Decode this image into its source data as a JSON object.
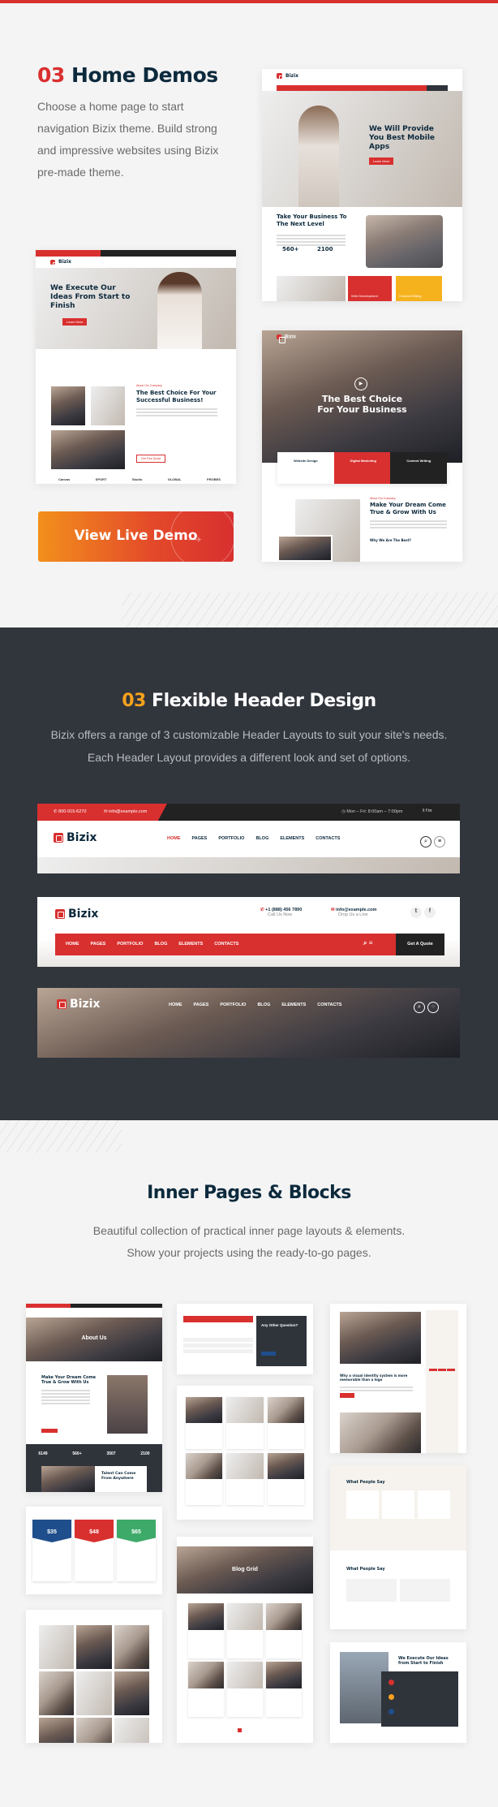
{
  "colors": {
    "accent": "#d8302f",
    "dark": "#2f343b",
    "navy": "#0d2a3d",
    "yellow": "#f6a21d"
  },
  "home_demos": {
    "number": "03",
    "title": "Home Demos",
    "description": "Choose a home page to start navigation Bizix theme. Build strong and impressive websites using Bizix pre-made theme.",
    "button": "View Live Demo",
    "demo1": {
      "logo": "Bizix",
      "hero": "We Will Provide You Best Mobile Apps",
      "section": "Take Your Business To The Next Level",
      "stat1": "560+",
      "stat2": "2100",
      "tile1": "Web Development",
      "tile2": "Content Writing",
      "cta": "Learn More"
    },
    "demo2": {
      "logo": "Bizix",
      "hero": "We Execute Our Ideas From Start to Finish",
      "section": "The Best Choice For Your Successful Business!",
      "kicker": "About Our Company",
      "cta": "Learn More",
      "cta2": "Get Free Quote",
      "brands": [
        "Canvas",
        "SPORT",
        "Studio",
        "GLOBAL",
        "PROBES"
      ]
    },
    "demo3": {
      "logo": "Bizix",
      "hero": "The Best Choice For Your Business",
      "box1": "Website Design",
      "box2": "Digital Marketing",
      "box3": "Content Writing",
      "section": "Make Your Dream Come True & Grow With Us",
      "sub": "Why We Are The Best?",
      "kicker": "About Our Company"
    }
  },
  "header_design": {
    "number": "03",
    "title": "Flexible Header Design",
    "description": "Bizix offers a range of 3 customizable Header Layouts to suit your site's needs. Each Header Layout provides a different look and set of options.",
    "nav": [
      "HOME",
      "PAGES",
      "PORTFOLIO",
      "BLOG",
      "ELEMENTS",
      "CONTACTS"
    ],
    "logo": "Bizix",
    "h1": {
      "phone": "800-915-6270",
      "email": "info@example.com",
      "hours": "Mon – Fri: 8:00am – 7:00pm"
    },
    "h2": {
      "phone": "+1 (888) 456 7890",
      "phone_sub": "Call Us Now",
      "email": "info@example.com",
      "email_sub": "Drop Us a Line",
      "quote": "Get A Quote"
    }
  },
  "inner_pages": {
    "title": "Inner Pages & Blocks",
    "description_line1": "Beautiful collection of practical inner page layouts & elements.",
    "description_line2": "Show your projects using the ready-to-go pages.",
    "about": {
      "banner": "About Us",
      "section": "Make Your Dream Come True & Grow With Us",
      "stats": [
        "6149",
        "560+",
        "3507",
        "2100"
      ],
      "talent": "Talent Can Come From Anywhere"
    },
    "pricing": [
      "$35",
      "$48",
      "$65"
    ],
    "faq": {
      "question": "Any Other Question?"
    },
    "blog_single": {
      "title": "Why a visual identity system is more memorable than a logo"
    },
    "testimonials": {
      "title": "What People Say"
    },
    "blog_grid": {
      "banner": "Blog Grid"
    },
    "process": {
      "title": "We Execute Our Ideas from Start to Finish"
    }
  }
}
